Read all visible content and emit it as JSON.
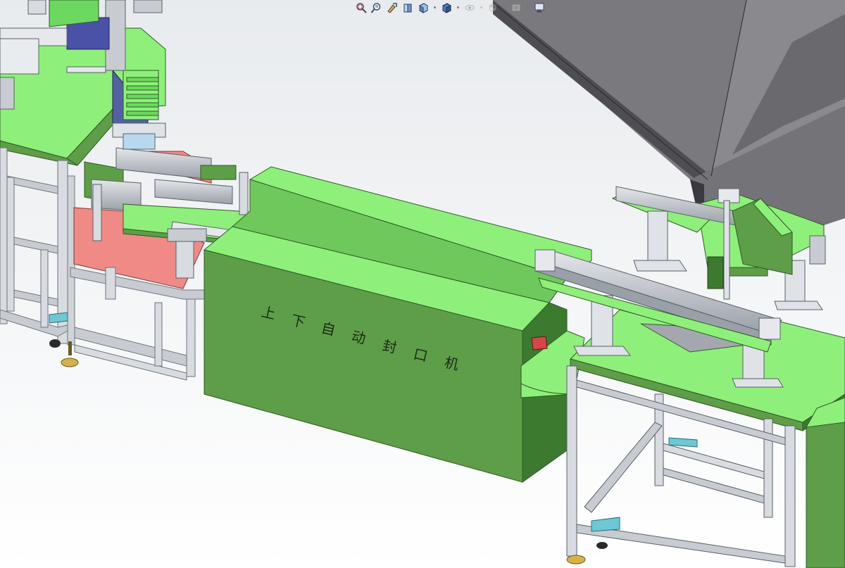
{
  "viewport": {
    "machine_label": "上下自动封口机",
    "machine_label_chars": [
      "上",
      "下",
      "自",
      "动",
      "封",
      "口",
      "机"
    ],
    "background_top": "#e8ebee",
    "background_bottom": "#ffffff",
    "green_top": "#8ef07a",
    "green_side": "#5e9e48",
    "green_dark": "#3c7a30",
    "frame_color": "#c8ccd2",
    "pink_table": "#f08a86",
    "grey_conveyor": "#6c6c70"
  },
  "hud_toolbar": {
    "buttons": [
      {
        "icon": "zoom-to-fit-icon"
      },
      {
        "icon": "zoom-to-area-icon"
      },
      {
        "icon": "previous-view-icon"
      },
      {
        "icon": "section-view-icon"
      },
      {
        "icon": "view-orientation-icon",
        "dropdown": true
      },
      {
        "icon": "display-style-icon",
        "dropdown": true
      },
      {
        "icon": "hide-show-items-icon",
        "dropdown": true
      },
      {
        "icon": "edit-appearance-icon",
        "dropdown": true
      },
      {
        "icon": "apply-scene-icon",
        "dropdown": true
      },
      {
        "icon": "view-settings-icon",
        "dropdown": true
      }
    ]
  }
}
